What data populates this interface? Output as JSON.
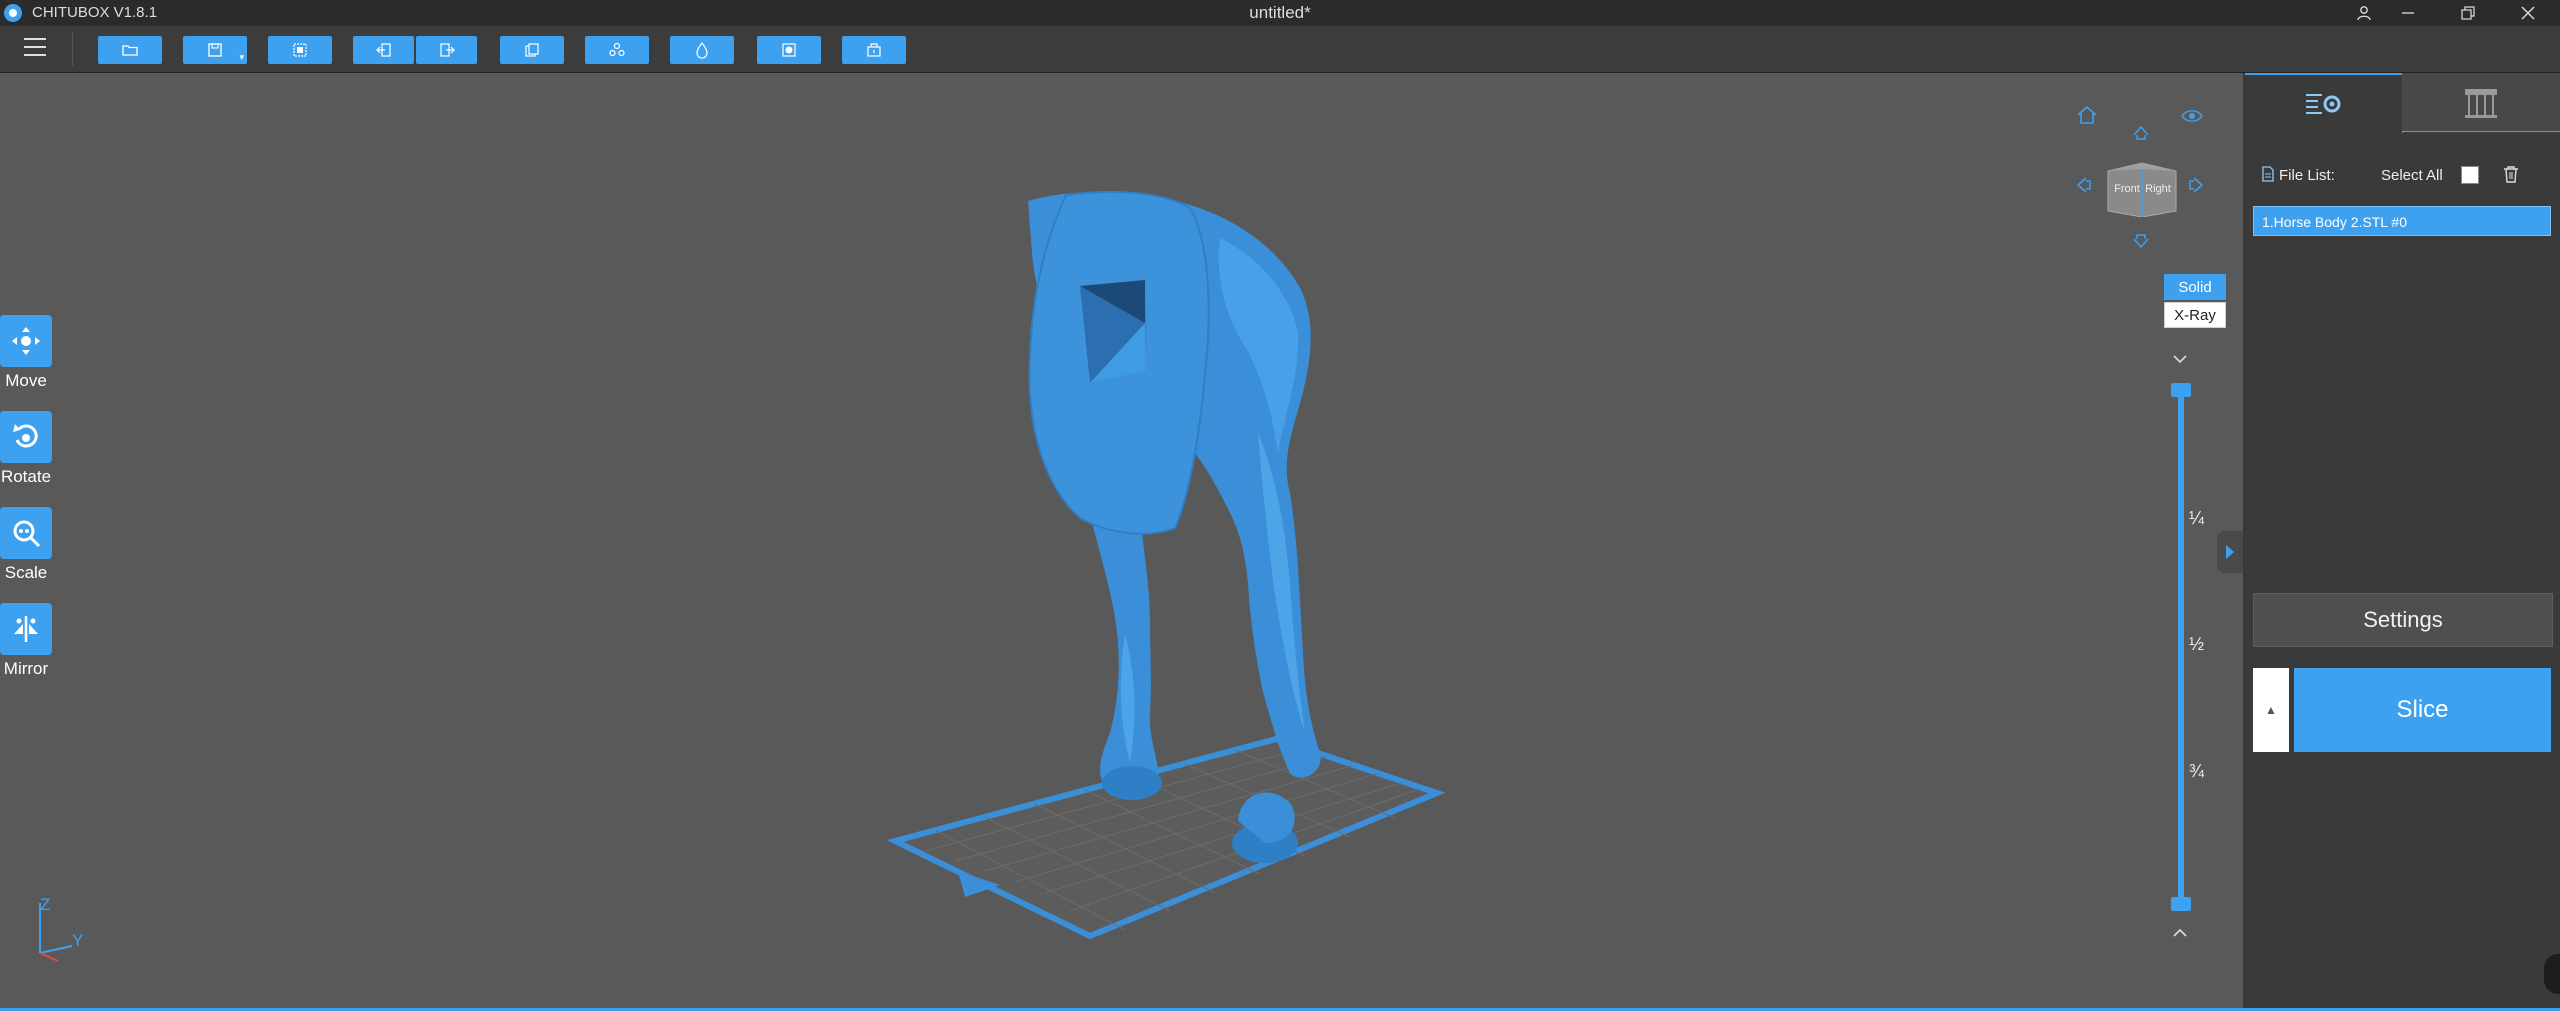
{
  "app": {
    "name": "CHITUBOX V1.8.1",
    "document_title": "untitled*"
  },
  "window_controls": [
    "user-icon",
    "minimize-icon",
    "restore-icon",
    "close-icon"
  ],
  "toolbar": {
    "buttons": [
      "open-file-icon",
      "save-icon",
      "select-all-icon",
      "import-icon",
      "export-icon",
      "duplicate-icon",
      "arrange-icon",
      "hollow-icon",
      "drill-icon",
      "support-box-icon"
    ]
  },
  "left_tools": [
    {
      "label": "Move",
      "icon": "move-icon"
    },
    {
      "label": "Rotate",
      "icon": "rotate-icon"
    },
    {
      "label": "Scale",
      "icon": "scale-icon"
    },
    {
      "label": "Mirror",
      "icon": "mirror-icon"
    }
  ],
  "view_cube": {
    "front": "Front",
    "right": "Right"
  },
  "view_modes": {
    "solid": "Solid",
    "xray": "X-Ray",
    "active": "Solid"
  },
  "layer_slider": {
    "marks": [
      "¼",
      "½",
      "¾"
    ]
  },
  "axes": {
    "z": "Z",
    "y": "Y"
  },
  "right_panel": {
    "tabs": [
      "settings-tab-icon",
      "support-tab-icon"
    ],
    "file_list_label": "File List:",
    "select_all_label": "Select All",
    "files": [
      "1.Horse Body 2.STL #0"
    ],
    "settings_label": "Settings",
    "slice_label": "Slice"
  },
  "colors": {
    "accent": "#3ea1f0",
    "model": "#3a8fd8",
    "viewport": "#595959",
    "panel": "#3a3a3a"
  }
}
